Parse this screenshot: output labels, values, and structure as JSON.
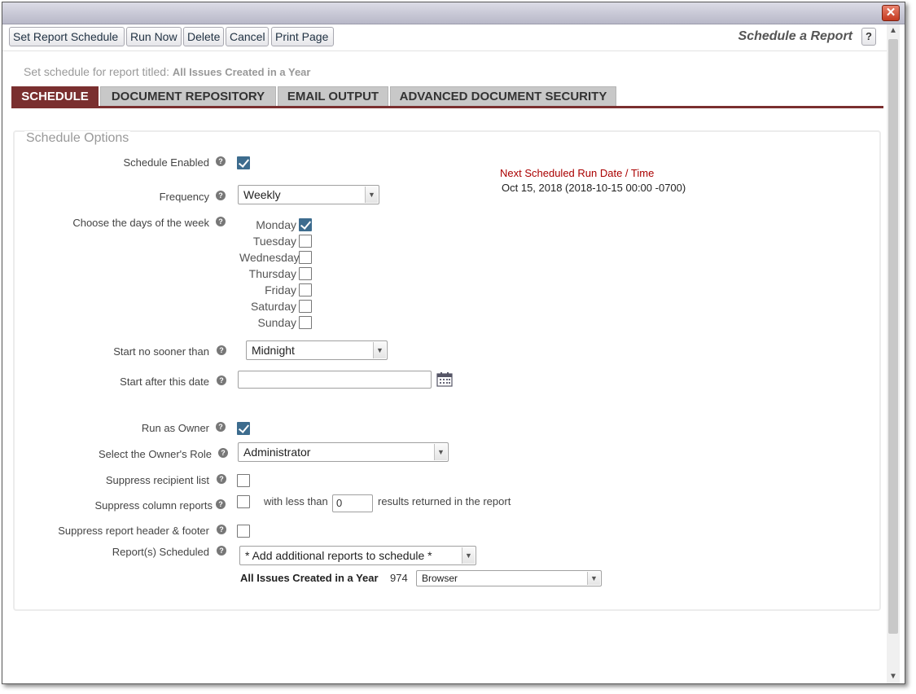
{
  "window": {
    "close_icon": "close-icon"
  },
  "toolbar": {
    "buttons": [
      "Set Report Schedule",
      "Run Now",
      "Delete",
      "Cancel",
      "Print Page"
    ],
    "heading": "Schedule a Report",
    "help": "?"
  },
  "subtitle": {
    "prefix": "Set schedule for report titled:",
    "report": "All Issues Created in a Year"
  },
  "tabs": [
    "SCHEDULE",
    "DOCUMENT REPOSITORY",
    "EMAIL OUTPUT",
    "ADVANCED DOCUMENT SECURITY"
  ],
  "active_tab": "SCHEDULE",
  "options": {
    "legend": "Schedule Options",
    "schedule_enabled": {
      "label": "Schedule Enabled",
      "checked": true
    },
    "frequency": {
      "label": "Frequency",
      "value": "Weekly"
    },
    "days": {
      "label": "Choose the days of the week",
      "items": [
        {
          "name": "Monday",
          "checked": true
        },
        {
          "name": "Tuesday",
          "checked": false
        },
        {
          "name": "Wednesday",
          "checked": false
        },
        {
          "name": "Thursday",
          "checked": false
        },
        {
          "name": "Friday",
          "checked": false
        },
        {
          "name": "Saturday",
          "checked": false
        },
        {
          "name": "Sunday",
          "checked": false
        }
      ]
    },
    "start_no_sooner": {
      "label": "Start no sooner than",
      "value": "Midnight"
    },
    "start_after_date": {
      "label": "Start after this date",
      "value": ""
    },
    "run_as_owner": {
      "label": "Run as Owner",
      "checked": true
    },
    "owner_role": {
      "label": "Select the Owner's Role",
      "value": "Administrator"
    },
    "suppress_recipient": {
      "label": "Suppress recipient list",
      "checked": false
    },
    "suppress_column": {
      "label": "Suppress column reports",
      "checked": false,
      "prefix": "with less than",
      "value": "0",
      "suffix": "results returned in the report"
    },
    "suppress_header": {
      "label": "Suppress report header & footer",
      "checked": false
    },
    "reports_scheduled": {
      "label": "Report(s) Scheduled",
      "add_placeholder": "* Add additional reports to schedule *",
      "report_name": "All Issues Created in a Year",
      "report_id": "974",
      "output": "Browser"
    }
  },
  "next_run": {
    "title": "Next Scheduled Run Date / Time",
    "value": "Oct 15, 2018 (2018-10-15 00:00 -0700)"
  },
  "colors": {
    "tab_active": "#7a2f2f",
    "checkbox_checked": "#3d6c8e",
    "next_run_title": "#aa0000"
  }
}
